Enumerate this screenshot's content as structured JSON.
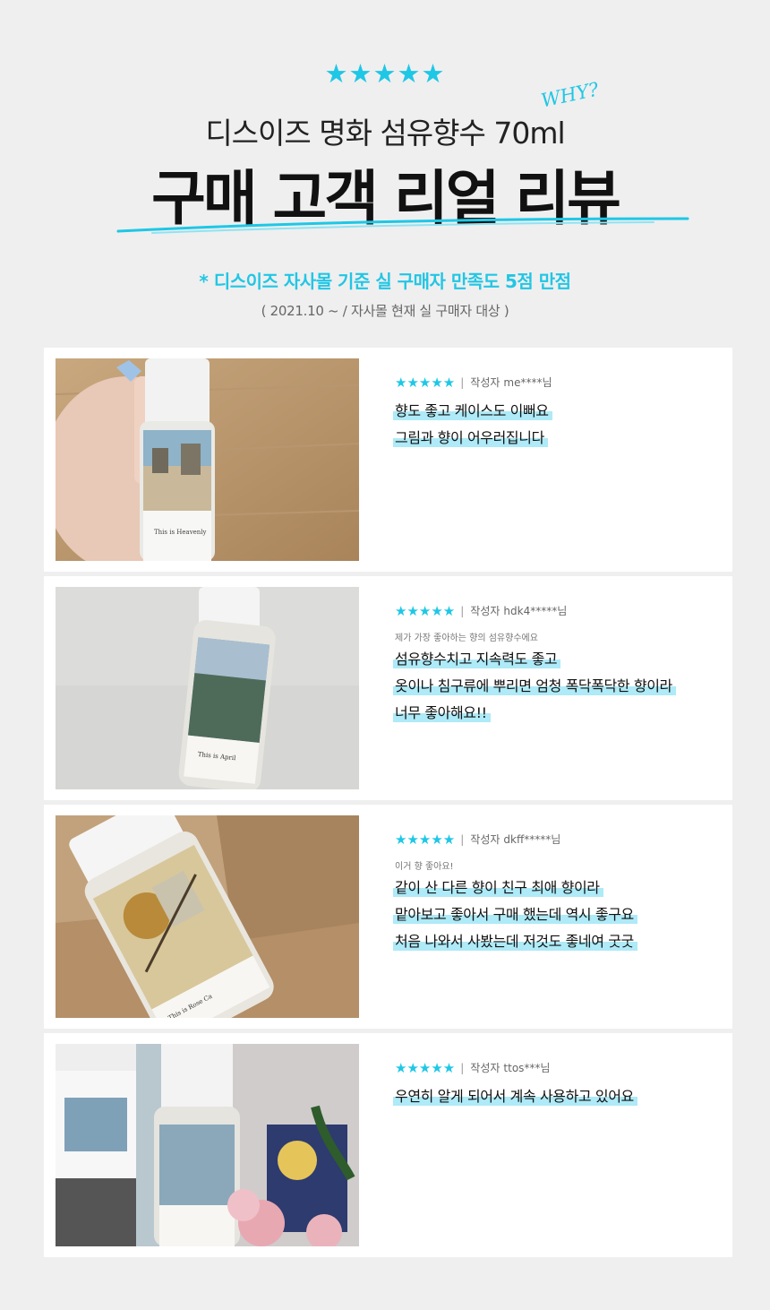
{
  "header": {
    "stars": "★★★★★",
    "product_title": "디스이즈 명화 섬유향수 70ml",
    "why_note": "WHY?",
    "main_title": "구매 고객 리얼 리뷰",
    "subtitle": "* 디스이즈 자사몰 기준 실 구매자 만족도 5점 만점",
    "period": "( 2021.10 ~ / 자사몰 현재 실 구매자 대상 )"
  },
  "colors": {
    "accent": "#1ec7e6",
    "highlight": "#aeeaf7",
    "background": "#efefef",
    "card": "#ffffff"
  },
  "reviews": [
    {
      "stars": "★★★★★",
      "author_label": "작성자",
      "author": "me****님",
      "intro": "",
      "lines": [
        "향도 좋고 케이스도 이뻐요",
        "그림과 향이 어우러집니다"
      ],
      "photo_alt": "hand holding perfume bottle with painting label"
    },
    {
      "stars": "★★★★★",
      "author_label": "작성자",
      "author": "hdk4*****님",
      "intro": "제가 가장 좋아하는 향의 섬유향수에요",
      "lines": [
        "섬유향수치고 지속력도 좋고",
        "옷이나 침구류에 뿌리면 엄청 폭닥폭닥한 향이라",
        "너무 좋아해요!!"
      ],
      "photo_alt": "perfume bottle with seascape painting label"
    },
    {
      "stars": "★★★★★",
      "author_label": "작성자",
      "author": "dkff*****님",
      "intro": "이거 향 좋아요!",
      "lines": [
        "같이 산 다른 향이 친구 최애 향이라",
        "맡아보고 좋아서 구매 했는데 역시 좋구요",
        "처음 나와서 사봤는데 저것도 좋네여 굿굿"
      ],
      "photo_alt": "perfume bottle with abstract painting label in a box"
    },
    {
      "stars": "★★★★★",
      "author_label": "작성자",
      "author": "ttos***님",
      "intro": "",
      "lines": [
        "우연히 알게 되어서 계속 사용하고 있어요"
      ],
      "photo_alt": "perfume bottles with diffuser box and roses"
    }
  ]
}
